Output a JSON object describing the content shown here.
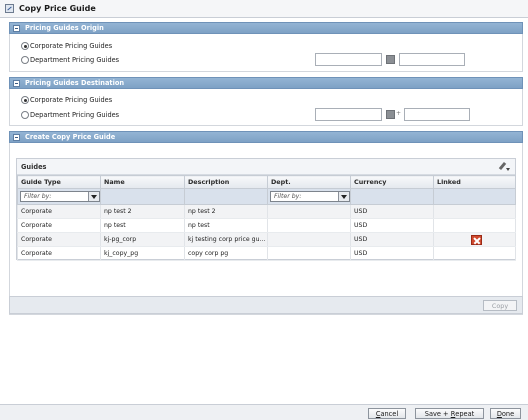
{
  "window": {
    "title": "Copy Price Guide",
    "icon": "copy-window-icon"
  },
  "origin": {
    "header": "Pricing Guides Origin",
    "radio_corporate": "Corporate Pricing Guides",
    "radio_department": "Department Pricing Guides",
    "selected": "corporate"
  },
  "destination": {
    "header": "Pricing Guides Destination",
    "radio_corporate": "Corporate Pricing Guides",
    "radio_department": "Department Pricing Guides",
    "selected": "corporate"
  },
  "create": {
    "header": "Create Copy Price Guide",
    "guides_label": "Guides",
    "columns": [
      "Guide Type",
      "Name",
      "Description",
      "Dept.",
      "Currency",
      "Linked"
    ],
    "filter_placeholder": "Filter by:",
    "rows": [
      {
        "type": "Corporate",
        "name": "np test 2",
        "description": "np test 2",
        "dept": "",
        "currency": "USD",
        "linked": false
      },
      {
        "type": "Corporate",
        "name": "np test",
        "description": "np test",
        "dept": "",
        "currency": "USD",
        "linked": false
      },
      {
        "type": "Corporate",
        "name": "kj-pg_corp",
        "description": "kj testing corp price gu...",
        "dept": "",
        "currency": "USD",
        "linked": true
      },
      {
        "type": "Corporate",
        "name": "kj_copy_pg",
        "description": "copy corp pg",
        "dept": "",
        "currency": "USD",
        "linked": false
      }
    ],
    "copy_button": "Copy"
  },
  "footer": {
    "cancel": {
      "pre": "",
      "u": "C",
      "post": "ancel"
    },
    "save_repeat": {
      "pre": "Save + ",
      "u": "R",
      "post": "epeat"
    },
    "done": {
      "pre": "",
      "u": "D",
      "post": "one"
    }
  }
}
